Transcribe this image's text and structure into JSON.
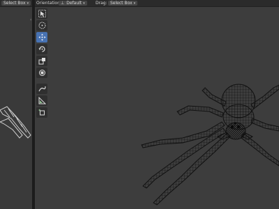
{
  "header": {
    "select_box_left": "Select Box",
    "orientation_label": "Orientation:",
    "orientation_value": "Default",
    "drag_label": "Drag:",
    "drag_value": "Select Box"
  },
  "toolbar": {
    "tools": [
      "select-box",
      "cursor",
      "move",
      "rotate",
      "scale",
      "transform",
      "annotate",
      "measure",
      "add-cube"
    ],
    "active_tool": "move",
    "accent_color": "#4772b3"
  }
}
